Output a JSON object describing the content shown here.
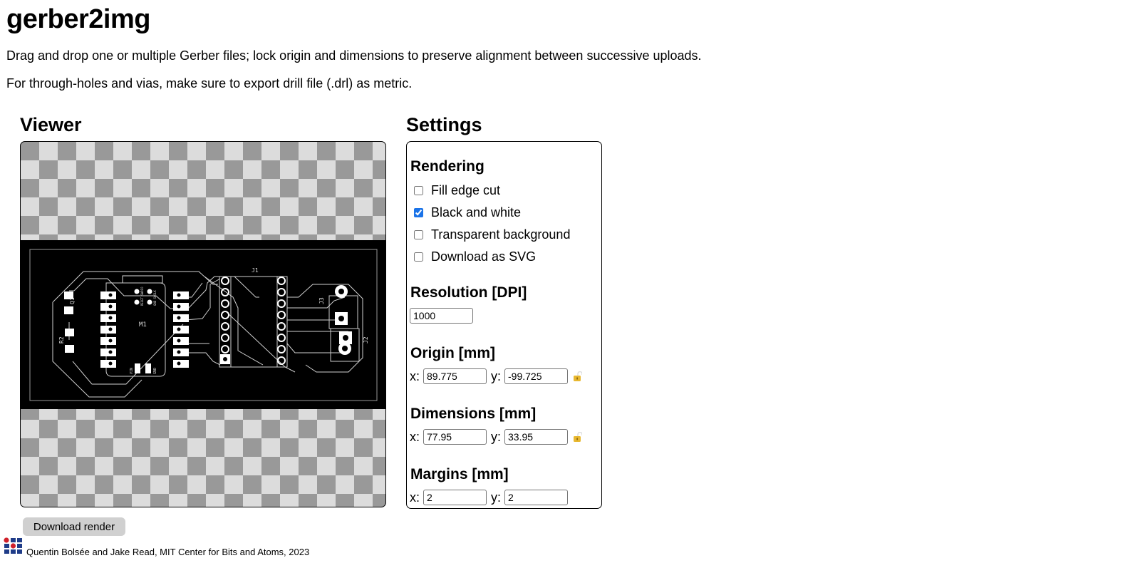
{
  "title": "gerber2img",
  "intro": {
    "line1": "Drag and drop one or multiple Gerber files; lock origin and dimensions to preserve alignment between successive uploads.",
    "line2": "For through-holes and vias, make sure to export drill file (.drl) as metric."
  },
  "viewer": {
    "title": "Viewer",
    "pcb_labels": {
      "m1": "M1",
      "q1": "Q1",
      "r2": "R2",
      "j1": "J1",
      "j2": "J2",
      "j3": "J3",
      "vin": "VIN",
      "gnd": "GND",
      "reset": "RESET SWDIO",
      "gndswclk": "GND SWCLK"
    }
  },
  "settings": {
    "title": "Settings",
    "rendering": {
      "heading": "Rendering",
      "options": [
        {
          "label": "Fill edge cut",
          "checked": false
        },
        {
          "label": "Black and white",
          "checked": true
        },
        {
          "label": "Transparent background",
          "checked": false
        },
        {
          "label": "Download as SVG",
          "checked": false
        }
      ]
    },
    "resolution": {
      "heading": "Resolution [DPI]",
      "value": "1000"
    },
    "origin": {
      "heading": "Origin [mm]",
      "x_label": "x:",
      "y_label": "y:",
      "x": "89.775",
      "y": "-99.725",
      "lock": "unlocked"
    },
    "dimensions": {
      "heading": "Dimensions [mm]",
      "x_label": "x:",
      "y_label": "y:",
      "x": "77.95",
      "y": "33.95",
      "lock": "unlocked"
    },
    "margins": {
      "heading": "Margins [mm]",
      "x_label": "x:",
      "y_label": "y:",
      "x": "2",
      "y": "2"
    }
  },
  "download_button": "Download render",
  "footer": {
    "credit": "Quentin Bolsée and Jake Read, MIT Center for Bits and Atoms, 2023"
  },
  "colors": {
    "lock": "#e8b830",
    "logo_red": "#d0202a",
    "logo_blue": "#1f3c88",
    "checkbox": "#1a73e8"
  }
}
